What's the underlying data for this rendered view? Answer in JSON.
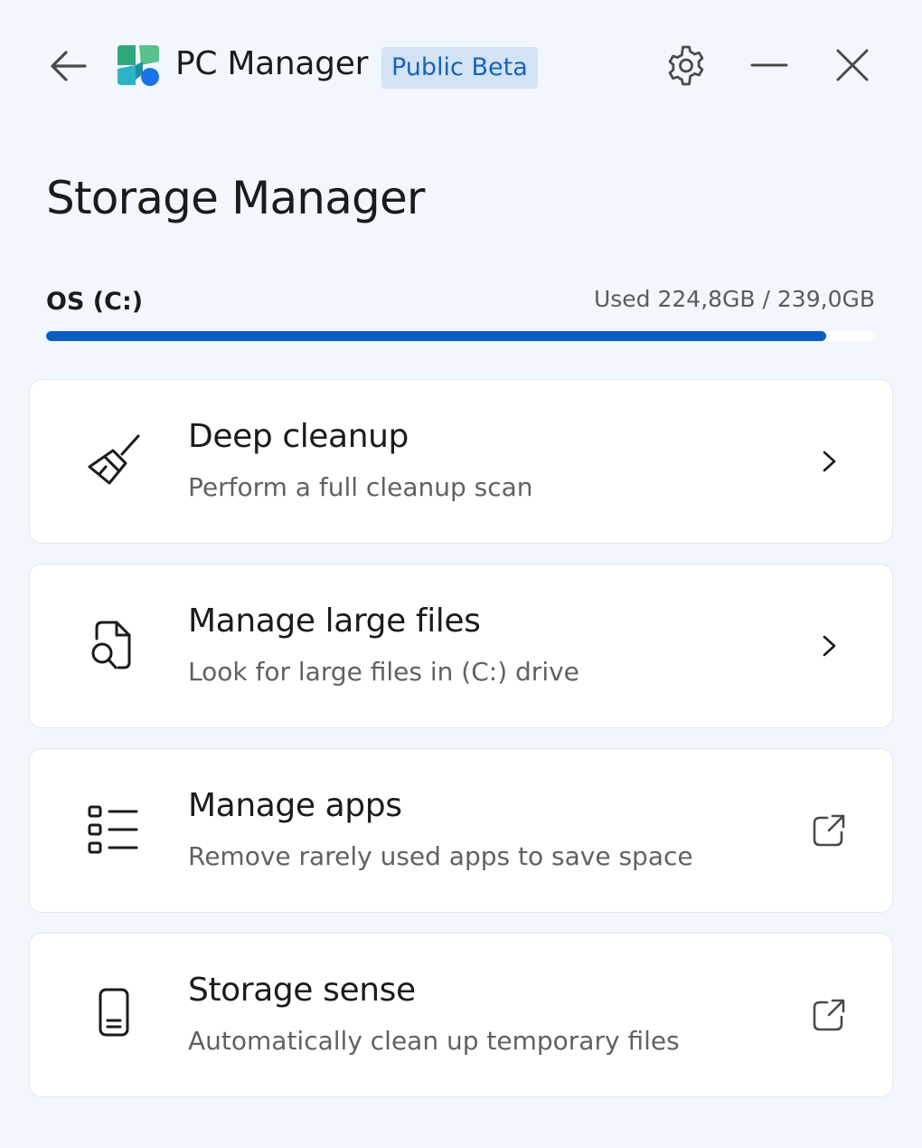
{
  "titlebar": {
    "app_name": "PC Manager",
    "badge": "Public Beta",
    "icons": {
      "back": "arrow-left-icon",
      "logo": "pc-manager-logo",
      "settings": "gear-icon",
      "minimize": "minimize-icon",
      "close": "close-icon"
    }
  },
  "page": {
    "title": "Storage Manager"
  },
  "drive": {
    "label": "OS (C:)",
    "usage_text": "Used 224,8GB / 239,0GB",
    "used_gb": 224.8,
    "total_gb": 239.0
  },
  "items": [
    {
      "title": "Deep cleanup",
      "subtitle": "Perform a full cleanup scan",
      "icon": "broom-icon",
      "trailing": "chevron-right-icon"
    },
    {
      "title": "Manage large files",
      "subtitle": "Look for large files in (C:) drive",
      "icon": "file-search-icon",
      "trailing": "chevron-right-icon"
    },
    {
      "title": "Manage apps",
      "subtitle": "Remove rarely used apps to save space",
      "icon": "app-list-icon",
      "trailing": "open-external-icon"
    },
    {
      "title": "Storage sense",
      "subtitle": "Automatically clean up temporary files",
      "icon": "phone-storage-icon",
      "trailing": "open-external-icon"
    }
  ],
  "colors": {
    "background": "#f2f7fd",
    "accent": "#0a5dc2",
    "badge_bg": "#d2e3f5",
    "badge_text": "#1a63b6"
  }
}
